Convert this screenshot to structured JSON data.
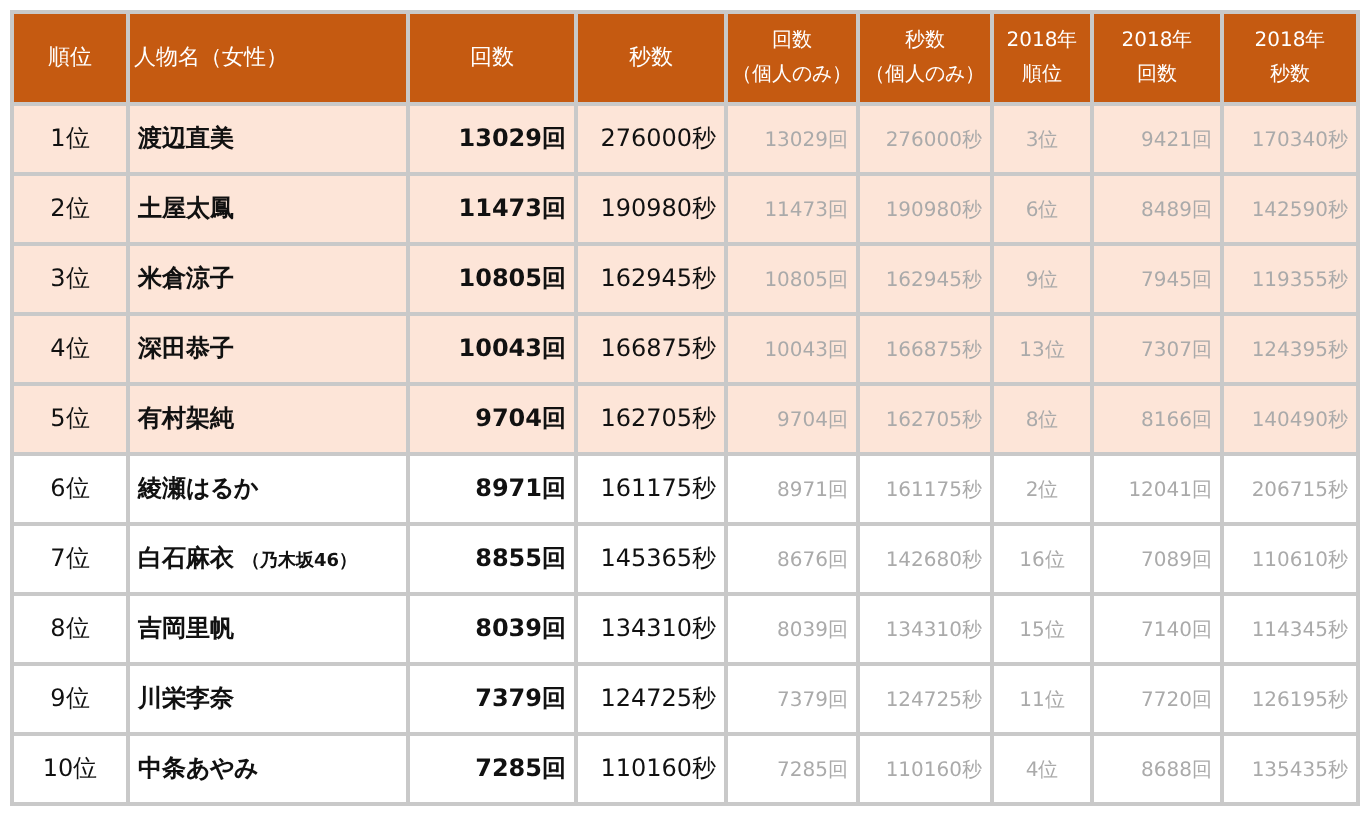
{
  "columns": [
    {
      "lines": [
        "順位"
      ]
    },
    {
      "lines": [
        "人物名（女性）"
      ]
    },
    {
      "lines": [
        "回数"
      ]
    },
    {
      "lines": [
        "秒数"
      ]
    },
    {
      "lines": [
        "回数",
        "（個人のみ）"
      ]
    },
    {
      "lines": [
        "秒数",
        "（個人のみ）"
      ]
    },
    {
      "lines": [
        "2018年",
        "順位"
      ]
    },
    {
      "lines": [
        "2018年",
        "回数"
      ]
    },
    {
      "lines": [
        "2018年",
        "秒数"
      ]
    }
  ],
  "rows": [
    {
      "highlighted": true,
      "rank": "1位",
      "name": "渡辺直美",
      "count": "13029回",
      "seconds": "276000秒",
      "solo_count": "13029回",
      "solo_seconds": "276000秒",
      "rank_2018": "3位",
      "count_2018": "9421回",
      "seconds_2018": "170340秒"
    },
    {
      "highlighted": true,
      "rank": "2位",
      "name": "土屋太鳳",
      "count": "11473回",
      "seconds": "190980秒",
      "solo_count": "11473回",
      "solo_seconds": "190980秒",
      "rank_2018": "6位",
      "count_2018": "8489回",
      "seconds_2018": "142590秒"
    },
    {
      "highlighted": true,
      "rank": "3位",
      "name": "米倉涼子",
      "count": "10805回",
      "seconds": "162945秒",
      "solo_count": "10805回",
      "solo_seconds": "162945秒",
      "rank_2018": "9位",
      "count_2018": "7945回",
      "seconds_2018": "119355秒"
    },
    {
      "highlighted": true,
      "rank": "4位",
      "name": "深田恭子",
      "count": "10043回",
      "seconds": "166875秒",
      "solo_count": "10043回",
      "solo_seconds": "166875秒",
      "rank_2018": "13位",
      "count_2018": "7307回",
      "seconds_2018": "124395秒"
    },
    {
      "highlighted": true,
      "rank": "5位",
      "name": "有村架純",
      "count": "9704回",
      "seconds": "162705秒",
      "solo_count": "9704回",
      "solo_seconds": "162705秒",
      "rank_2018": "8位",
      "count_2018": "8166回",
      "seconds_2018": "140490秒"
    },
    {
      "highlighted": false,
      "rank": "6位",
      "name": "綾瀬はるか",
      "count": "8971回",
      "seconds": "161175秒",
      "solo_count": "8971回",
      "solo_seconds": "161175秒",
      "rank_2018": "2位",
      "count_2018": "12041回",
      "seconds_2018": "206715秒"
    },
    {
      "highlighted": false,
      "rank": "7位",
      "name": "白石麻衣",
      "note": "（乃木坂46）",
      "count": "8855回",
      "seconds": "145365秒",
      "solo_count": "8676回",
      "solo_seconds": "142680秒",
      "rank_2018": "16位",
      "count_2018": "7089回",
      "seconds_2018": "110610秒"
    },
    {
      "highlighted": false,
      "rank": "8位",
      "name": "吉岡里帆",
      "count": "8039回",
      "seconds": "134310秒",
      "solo_count": "8039回",
      "solo_seconds": "134310秒",
      "rank_2018": "15位",
      "count_2018": "7140回",
      "seconds_2018": "114345秒"
    },
    {
      "highlighted": false,
      "rank": "9位",
      "name": "川栄李奈",
      "count": "7379回",
      "seconds": "124725秒",
      "solo_count": "7379回",
      "solo_seconds": "124725秒",
      "rank_2018": "11位",
      "count_2018": "7720回",
      "seconds_2018": "126195秒"
    },
    {
      "highlighted": false,
      "rank": "10位",
      "name": "中条あやみ",
      "count": "7285回",
      "seconds": "110160秒",
      "solo_count": "7285回",
      "solo_seconds": "110160秒",
      "rank_2018": "4位",
      "count_2018": "8688回",
      "seconds_2018": "135435秒"
    }
  ]
}
